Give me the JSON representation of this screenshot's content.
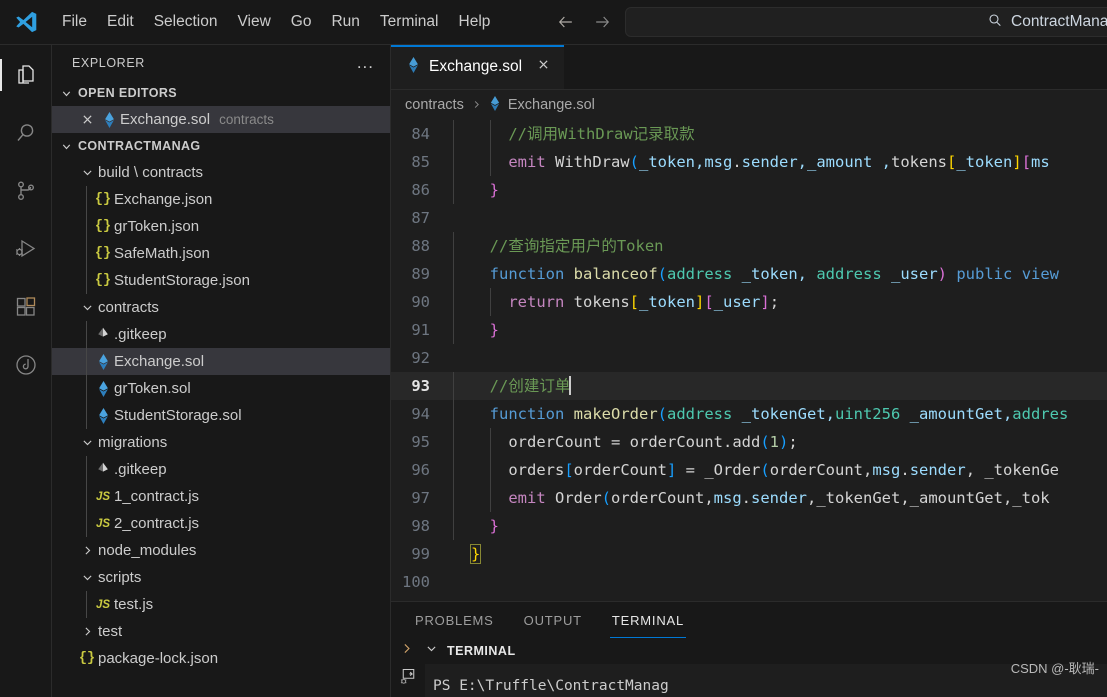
{
  "titlebar": {
    "logo_icon": "vscode-logo-icon",
    "menus": [
      "File",
      "Edit",
      "Selection",
      "View",
      "Go",
      "Run",
      "Terminal",
      "Help"
    ],
    "back_icon": "arrow-left-icon",
    "forward_icon": "arrow-right-icon",
    "search": {
      "icon": "search-icon",
      "value": "ContractManag",
      "placeholder": ""
    }
  },
  "activitybar": {
    "items": [
      {
        "name": "explorer",
        "icon": "files-icon",
        "active": true
      },
      {
        "name": "search",
        "icon": "search-icon",
        "active": false
      },
      {
        "name": "source-control",
        "icon": "source-control-icon",
        "active": false
      },
      {
        "name": "run-and-debug",
        "icon": "run-debug-icon",
        "active": false
      },
      {
        "name": "extensions",
        "icon": "extensions-icon",
        "active": false
      },
      {
        "name": "testing",
        "icon": "testing-beaker-icon",
        "active": false
      }
    ]
  },
  "sidebar": {
    "title": "EXPLORER",
    "more_actions_label": "...",
    "open_editors": {
      "label": "OPEN EDITORS",
      "expanded": true,
      "items": [
        {
          "close_icon": "close-icon",
          "icon": "solidity-icon",
          "name": "Exchange.sol",
          "folder": "contracts",
          "selected": true
        }
      ]
    },
    "project": {
      "label": "CONTRACTMANAG",
      "expanded": true,
      "tree": [
        {
          "type": "folder",
          "label": "build \\ contracts",
          "expanded": true,
          "depth": 1
        },
        {
          "type": "json",
          "label": "Exchange.json",
          "depth": 2
        },
        {
          "type": "json",
          "label": "grToken.json",
          "depth": 2
        },
        {
          "type": "json",
          "label": "SafeMath.json",
          "depth": 2
        },
        {
          "type": "json",
          "label": "StudentStorage.json",
          "depth": 2
        },
        {
          "type": "folder",
          "label": "contracts",
          "expanded": true,
          "depth": 1
        },
        {
          "type": "gitkeep",
          "label": ".gitkeep",
          "depth": 2
        },
        {
          "type": "sol",
          "label": "Exchange.sol",
          "depth": 2,
          "selected": true
        },
        {
          "type": "sol",
          "label": "grToken.sol",
          "depth": 2
        },
        {
          "type": "sol",
          "label": "StudentStorage.sol",
          "depth": 2
        },
        {
          "type": "folder",
          "label": "migrations",
          "expanded": true,
          "depth": 1
        },
        {
          "type": "gitkeep",
          "label": ".gitkeep",
          "depth": 2
        },
        {
          "type": "js",
          "label": "1_contract.js",
          "depth": 2
        },
        {
          "type": "js",
          "label": "2_contract.js",
          "depth": 2
        },
        {
          "type": "folder",
          "label": "node_modules",
          "expanded": false,
          "depth": 1
        },
        {
          "type": "folder",
          "label": "scripts",
          "expanded": true,
          "depth": 1
        },
        {
          "type": "js",
          "label": "test.js",
          "depth": 2
        },
        {
          "type": "folder",
          "label": "test",
          "expanded": false,
          "depth": 1
        },
        {
          "type": "json",
          "label": "package-lock.json",
          "depth": 1
        }
      ]
    }
  },
  "editor": {
    "tab": {
      "icon": "solidity-icon",
      "label": "Exchange.sol",
      "close_icon": "close-icon"
    },
    "breadcrumb": {
      "folder": "contracts",
      "separator": ">",
      "file_icon": "solidity-icon",
      "file": "Exchange.sol"
    },
    "first_line_number": 84,
    "active_line": 93,
    "lines": [
      {
        "n": 84,
        "indent": 2,
        "tokens": [
          {
            "t": "    //调用WithDraw记录取款",
            "c": "c-com"
          }
        ]
      },
      {
        "n": 85,
        "indent": 2,
        "tokens": [
          {
            "t": "    ",
            "c": "c-pl"
          },
          {
            "t": "emit",
            "c": "c-kw2"
          },
          {
            "t": " WithDraw",
            "c": "c-pl"
          },
          {
            "t": "(",
            "c": "c-b3"
          },
          {
            "t": "_token,",
            "c": "c-var"
          },
          {
            "t": "msg",
            "c": "c-var"
          },
          {
            "t": ".",
            "c": "c-pl"
          },
          {
            "t": "sender",
            "c": "c-var"
          },
          {
            "t": ",_amount ,",
            "c": "c-var"
          },
          {
            "t": "tokens",
            "c": "c-pl"
          },
          {
            "t": "[",
            "c": "c-b1"
          },
          {
            "t": "_token",
            "c": "c-var"
          },
          {
            "t": "]",
            "c": "c-b1"
          },
          {
            "t": "[",
            "c": "c-b2"
          },
          {
            "t": "ms",
            "c": "c-var"
          }
        ]
      },
      {
        "n": 86,
        "indent": 1,
        "tokens": [
          {
            "t": "  }",
            "c": "c-b2"
          }
        ]
      },
      {
        "n": 87,
        "indent": 0,
        "tokens": []
      },
      {
        "n": 88,
        "indent": 1,
        "tokens": [
          {
            "t": "  //查询指定用户的Token",
            "c": "c-com"
          }
        ]
      },
      {
        "n": 89,
        "indent": 1,
        "tokens": [
          {
            "t": "  ",
            "c": "c-pl"
          },
          {
            "t": "function",
            "c": "c-kw"
          },
          {
            "t": " balanceof",
            "c": "c-fn"
          },
          {
            "t": "(",
            "c": "c-b3"
          },
          {
            "t": "address",
            "c": "c-type"
          },
          {
            "t": " _token, ",
            "c": "c-var"
          },
          {
            "t": "address",
            "c": "c-type"
          },
          {
            "t": " _user",
            "c": "c-var"
          },
          {
            "t": ")",
            "c": "c-b2"
          },
          {
            "t": " ",
            "c": "c-pl"
          },
          {
            "t": "public",
            "c": "c-kw"
          },
          {
            "t": " ",
            "c": "c-pl"
          },
          {
            "t": "view",
            "c": "c-kw"
          }
        ]
      },
      {
        "n": 90,
        "indent": 2,
        "tokens": [
          {
            "t": "    ",
            "c": "c-pl"
          },
          {
            "t": "return",
            "c": "c-kw2"
          },
          {
            "t": " tokens",
            "c": "c-pl"
          },
          {
            "t": "[",
            "c": "c-b1"
          },
          {
            "t": "_token",
            "c": "c-var"
          },
          {
            "t": "]",
            "c": "c-b1"
          },
          {
            "t": "[",
            "c": "c-b2"
          },
          {
            "t": "_user",
            "c": "c-var"
          },
          {
            "t": "]",
            "c": "c-b2"
          },
          {
            "t": ";",
            "c": "c-pl"
          }
        ]
      },
      {
        "n": 91,
        "indent": 1,
        "tokens": [
          {
            "t": "  }",
            "c": "c-b2"
          }
        ]
      },
      {
        "n": 92,
        "indent": 0,
        "tokens": []
      },
      {
        "n": 93,
        "indent": 1,
        "active": true,
        "tokens": [
          {
            "t": "  //创建订单",
            "c": "c-com"
          }
        ],
        "caret": true
      },
      {
        "n": 94,
        "indent": 1,
        "tokens": [
          {
            "t": "  ",
            "c": "c-pl"
          },
          {
            "t": "function",
            "c": "c-kw"
          },
          {
            "t": " makeOrder",
            "c": "c-fn"
          },
          {
            "t": "(",
            "c": "c-b3"
          },
          {
            "t": "address",
            "c": "c-type"
          },
          {
            "t": " _tokenGet,",
            "c": "c-var"
          },
          {
            "t": "uint256",
            "c": "c-type"
          },
          {
            "t": " _amountGet,",
            "c": "c-var"
          },
          {
            "t": "addres",
            "c": "c-type"
          }
        ]
      },
      {
        "n": 95,
        "indent": 2,
        "tokens": [
          {
            "t": "    orderCount ",
            "c": "c-pl"
          },
          {
            "t": "= ",
            "c": "c-pl"
          },
          {
            "t": "orderCount",
            "c": "c-pl"
          },
          {
            "t": ".",
            "c": "c-pl"
          },
          {
            "t": "add",
            "c": "c-pl"
          },
          {
            "t": "(",
            "c": "c-b3"
          },
          {
            "t": "1",
            "c": "c-num"
          },
          {
            "t": ")",
            "c": "c-b3"
          },
          {
            "t": ";",
            "c": "c-pl"
          }
        ]
      },
      {
        "n": 96,
        "indent": 2,
        "tokens": [
          {
            "t": "    orders",
            "c": "c-pl"
          },
          {
            "t": "[",
            "c": "c-b3"
          },
          {
            "t": "orderCount",
            "c": "c-pl"
          },
          {
            "t": "]",
            "c": "c-b3"
          },
          {
            "t": " = _Order",
            "c": "c-pl"
          },
          {
            "t": "(",
            "c": "c-b3"
          },
          {
            "t": "orderCount,",
            "c": "c-pl"
          },
          {
            "t": "msg",
            "c": "c-var"
          },
          {
            "t": ".",
            "c": "c-pl"
          },
          {
            "t": "sender",
            "c": "c-var"
          },
          {
            "t": ", _tokenGe",
            "c": "c-pl"
          }
        ]
      },
      {
        "n": 97,
        "indent": 2,
        "tokens": [
          {
            "t": "    ",
            "c": "c-pl"
          },
          {
            "t": "emit",
            "c": "c-kw2"
          },
          {
            "t": " Order",
            "c": "c-pl"
          },
          {
            "t": "(",
            "c": "c-b3"
          },
          {
            "t": "orderCount,",
            "c": "c-pl"
          },
          {
            "t": "msg",
            "c": "c-var"
          },
          {
            "t": ".",
            "c": "c-pl"
          },
          {
            "t": "sender",
            "c": "c-var"
          },
          {
            "t": ",_tokenGet,_amountGet,_tok",
            "c": "c-pl"
          }
        ]
      },
      {
        "n": 98,
        "indent": 1,
        "tokens": [
          {
            "t": "  }",
            "c": "c-b2"
          }
        ]
      },
      {
        "n": 99,
        "indent": 0,
        "tokens": [
          {
            "t": "}",
            "c": "c-b1",
            "match": true
          }
        ]
      },
      {
        "n": 100,
        "indent": 0,
        "tokens": []
      }
    ]
  },
  "panel": {
    "tabs": [
      {
        "label": "PROBLEMS",
        "active": false
      },
      {
        "label": "OUTPUT",
        "active": false
      },
      {
        "label": "TERMINAL",
        "active": true
      }
    ],
    "terminal": {
      "expand_icon": "chevron-right-icon",
      "collapse_icon": "chevron-down-icon",
      "title": "TERMINAL",
      "split_icon": "terminal-split-icon",
      "content": "PS E:\\Truffle\\ContractManag"
    }
  },
  "watermark": "CSDN @-耿瑞-",
  "colors": {
    "accent": "#0078d4",
    "titlebar_bg": "#181818",
    "editor_bg": "#1e1e1e",
    "sidebar_bg": "#181818",
    "selection_bg": "#37373d",
    "comment": "#6a9955",
    "keyword": "#569cd6",
    "control_keyword": "#c586c0",
    "function": "#dcdcaa",
    "type": "#4ec9b0",
    "variable": "#9cdcfe",
    "number": "#b5cea8"
  }
}
